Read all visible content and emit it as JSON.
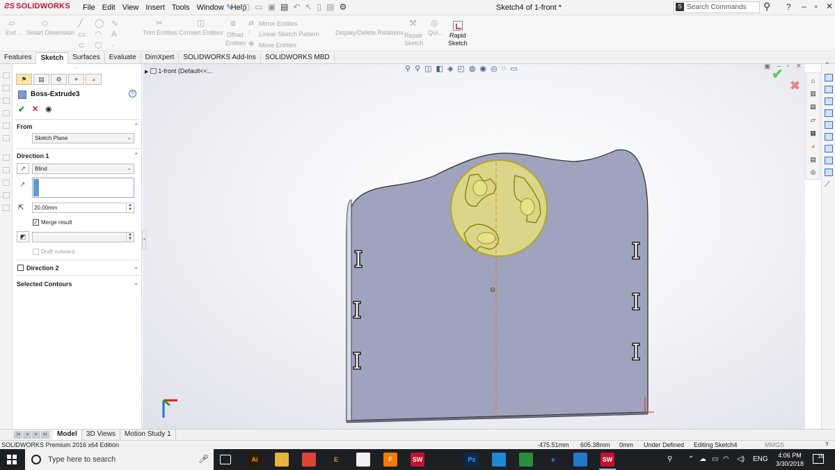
{
  "app": {
    "brand": "SOLIDWORKS",
    "menu": [
      "File",
      "Edit",
      "View",
      "Insert",
      "Tools",
      "Window",
      "Help"
    ],
    "doc_title": "Sketch4 of 1-front *",
    "search_placeholder": "Search Commands"
  },
  "commands": {
    "exit": "Exit ...",
    "smart_dimension": "Smart Dimension",
    "trim": "Trim Entities",
    "convert": "Convert Entities",
    "offset_1": "Offset",
    "offset_2": "Entities",
    "mirror": "Mirror Entities",
    "linear_pattern": "Linear Sketch Pattern",
    "move": "Move Entities",
    "display_delete": "Display/Delete Relations",
    "repair_1": "Repair",
    "repair_2": "Sketch",
    "quick": "Qui...",
    "rapid_1": "Rapid",
    "rapid_2": "Sketch"
  },
  "tabs": [
    "Features",
    "Sketch",
    "Surfaces",
    "Evaluate",
    "DimXpert",
    "SOLIDWORKS Add-Ins",
    "SOLIDWORKS MBD"
  ],
  "active_tab": "Sketch",
  "property_manager": {
    "title": "Boss-Extrude3",
    "from_label": "From",
    "from_value": "Sketch Plane",
    "direction1_label": "Direction 1",
    "end_condition": "Blind",
    "depth": "20.00mm",
    "merge_label": "Merge result",
    "merge_checked": true,
    "draft_label": "Draft outward",
    "direction2_label": "Direction 2",
    "selected_contours_label": "Selected Contours"
  },
  "tree": {
    "root": "1-front  (Default<<..."
  },
  "bottom_tabs": [
    "Model",
    "3D Views",
    "Motion Study 1"
  ],
  "active_bottom_tab": "Model",
  "status": {
    "edition": "SOLIDWORKS Premium 2016 x64 Edition",
    "x": "-475.51mm",
    "y": "605.38mm",
    "z": "0mm",
    "state": "Under Defined",
    "editing": "Editing Sketch4",
    "units": "MMGS"
  },
  "taskbar": {
    "search_placeholder": "Type here to search",
    "lang": "ENG",
    "time": "4:06 PM",
    "date": "3/30/2018",
    "notif_count": "16",
    "apps": [
      {
        "label": "Ai",
        "color": "#2d1a05",
        "fg": "#ff9a00"
      },
      {
        "label": "",
        "color": "#e8b33a",
        "fg": "#ffffff"
      },
      {
        "label": "",
        "color": "#db4437",
        "fg": "#ffffff"
      },
      {
        "label": "E",
        "color": "#1c1f24",
        "fg": "#f08a24"
      },
      {
        "label": "",
        "color": "#f2f2f2",
        "fg": "#333333"
      },
      {
        "label": "F",
        "color": "#f57c00",
        "fg": "#ffffff"
      },
      {
        "label": "SW",
        "color": "#c8102e",
        "fg": "#ffffff"
      },
      {
        "label": "",
        "color": "#1c1f24",
        "fg": "#ffffff"
      },
      {
        "label": "Ps",
        "color": "#0c2a4d",
        "fg": "#31a8ff"
      },
      {
        "label": "",
        "color": "#1f8ad2",
        "fg": "#ffffff"
      },
      {
        "label": "",
        "color": "#2b8c3e",
        "fg": "#ffd200"
      },
      {
        "label": "e",
        "color": "#1c1f24",
        "fg": "#2d8fe0"
      },
      {
        "label": "",
        "color": "#2477c9",
        "fg": "#ffffff"
      },
      {
        "label": "SW",
        "color": "#c8102e",
        "fg": "#ffffff"
      }
    ]
  }
}
